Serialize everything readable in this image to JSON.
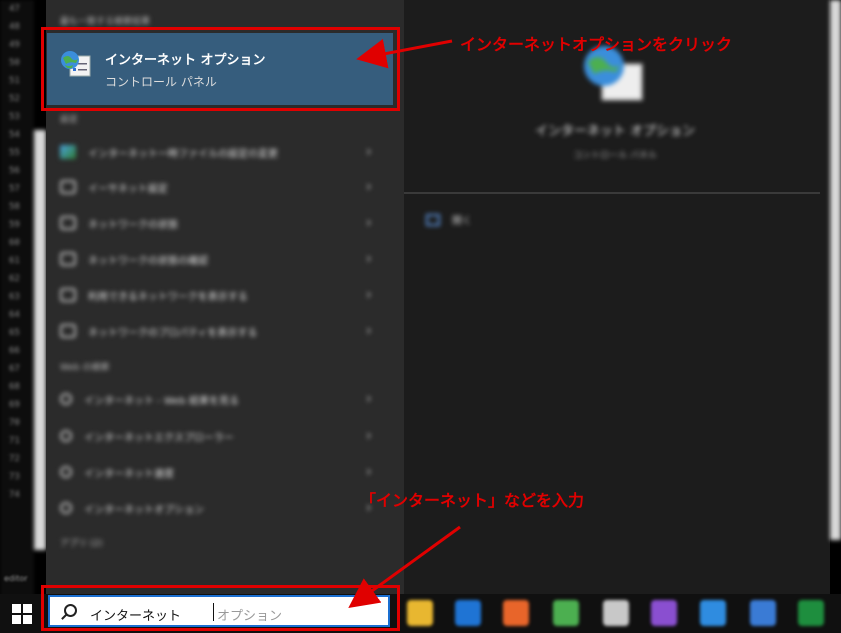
{
  "gutter": {
    "line_numbers": [
      "47",
      "48",
      "49",
      "50",
      "51",
      "52",
      "53",
      "54",
      "55",
      "56",
      "57",
      "58",
      "59",
      "60",
      "61",
      "62",
      "63",
      "64",
      "65",
      "66",
      "67",
      "68",
      "69",
      "70",
      "71",
      "72",
      "73",
      "74"
    ]
  },
  "start_menu": {
    "best_match_header": "最も一致する検索結果",
    "best_match": {
      "title": "インターネット オプション",
      "subtitle": "コントロール パネル",
      "icon": "internet-options-icon"
    },
    "settings_header": "設定",
    "settings_items": [
      {
        "label": "インターネット一時ファイルの設定の変更",
        "icon": "internet-settings-icon"
      },
      {
        "label": "イーサネット設定",
        "icon": "ethernet-icon"
      },
      {
        "label": "ネットワークの状態",
        "icon": "gear-icon"
      },
      {
        "label": "ネットワークの状態の確認",
        "icon": "gear-icon"
      },
      {
        "label": "利用できるネットワークを表示する",
        "icon": "gear-icon"
      },
      {
        "label": "ネットワークのプロパティを表示する",
        "icon": "gear-icon"
      }
    ],
    "web_header": "Web の検索",
    "web_items": [
      {
        "label": "インターネット - Web 結果を見る",
        "icon": "search-icon"
      },
      {
        "label": "インターネットエクスプローラー",
        "icon": "search-icon"
      },
      {
        "label": "インターネット速度",
        "icon": "search-icon"
      },
      {
        "label": "インターネットオプション",
        "icon": "search-icon"
      }
    ],
    "apps_header": "アプリ (2)",
    "arrow_glyph": "›"
  },
  "detail": {
    "title": "インターネット オプション",
    "subtitle": "コントロール パネル",
    "open_label": "開く"
  },
  "search": {
    "typed": "インターネット",
    "suggestion": "オプション"
  },
  "taskbar": {
    "corner_text": "editor",
    "apps": [
      {
        "name": "file-explorer-icon",
        "color": "#e8b730"
      },
      {
        "name": "outlook-icon",
        "color": "#1f74d4"
      },
      {
        "name": "firefox-icon",
        "color": "#e8652a"
      },
      {
        "name": "chrome-icon",
        "color": "#4caf50"
      },
      {
        "name": "notepad-icon",
        "color": "#c8c8c8"
      },
      {
        "name": "visual-studio-icon",
        "color": "#8a4fd0"
      },
      {
        "name": "vscode-icon",
        "color": "#2f8ce0"
      },
      {
        "name": "calculator-icon",
        "color": "#3a7bd5"
      },
      {
        "name": "excel-icon",
        "color": "#1e8e3e"
      }
    ]
  },
  "annotations": {
    "click_callout": "インターネットオプションをクリック",
    "input_callout": "「インターネット」などを入力",
    "color": "#e00000"
  }
}
